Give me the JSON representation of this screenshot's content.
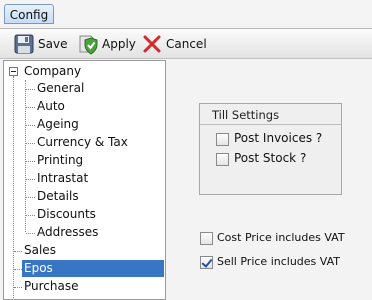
{
  "tab": {
    "label": "Config"
  },
  "toolbar": {
    "save_label": "Save",
    "apply_label": "Apply",
    "cancel_label": "Cancel"
  },
  "tree": {
    "root": "Company",
    "children": [
      "General",
      "Auto",
      "Ageing",
      "Currency & Tax",
      "Printing",
      "Intrastat",
      "Details",
      "Discounts",
      "Addresses"
    ],
    "siblings": [
      "Sales",
      "Epos",
      "Purchase"
    ],
    "selected": "Epos"
  },
  "till_settings": {
    "title": "Till Settings",
    "post_invoices": {
      "label": "Post Invoices ?",
      "checked": false
    },
    "post_stock": {
      "label": "Post Stock ?",
      "checked": false
    }
  },
  "vat": {
    "cost_price": {
      "label": "Cost Price includes VAT",
      "checked": false
    },
    "sell_price": {
      "label": "Sell Price includes VAT",
      "checked": true
    }
  },
  "colors": {
    "selection": "#3875c4",
    "tab": "#c5dcf4",
    "cancel": "#d42a2a"
  }
}
